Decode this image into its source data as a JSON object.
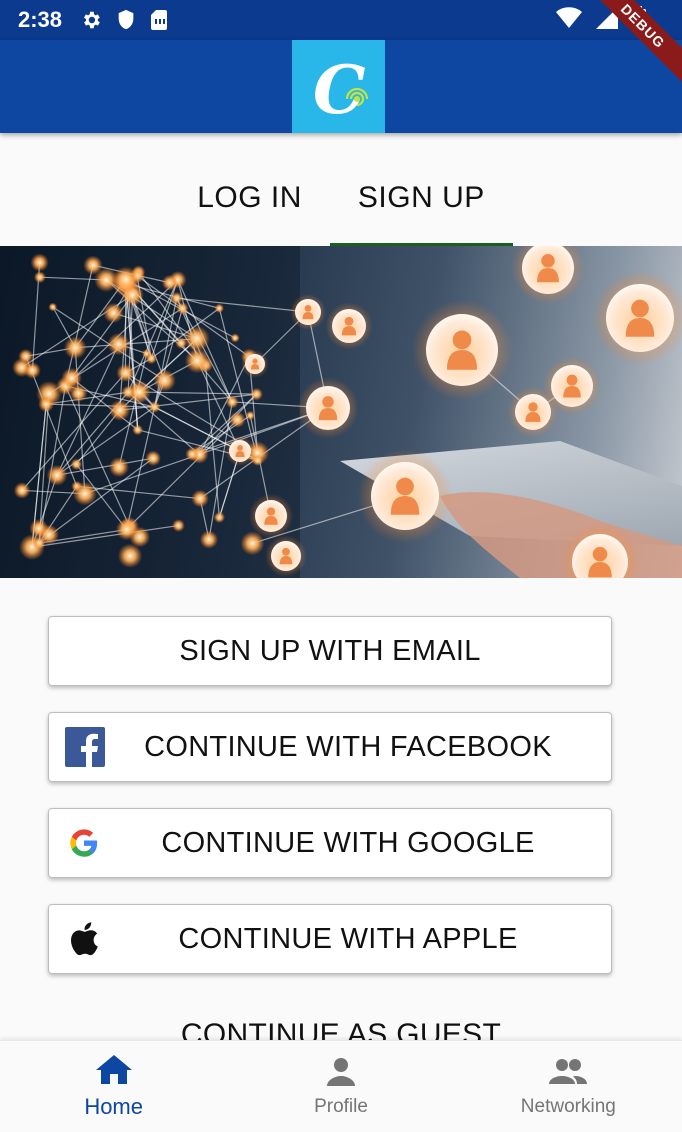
{
  "status_bar": {
    "time": "2:38",
    "icons": [
      "settings-icon",
      "shield-icon",
      "sim-card-icon",
      "wifi-icon",
      "signal-icon",
      "battery-icon"
    ]
  },
  "app_bar": {
    "logo_letter": "C",
    "debug_banner": "DEBUG",
    "color": "#0d47a1",
    "logo_bg": "#29b6e8"
  },
  "tabs": [
    {
      "label": "LOG IN",
      "active": false
    },
    {
      "label": "SIGN UP",
      "active": true
    }
  ],
  "hero": {
    "icon": "network-people-image"
  },
  "buttons": {
    "email": {
      "label": "SIGN UP WITH EMAIL"
    },
    "facebook": {
      "label": "CONTINUE WITH FACEBOOK",
      "icon": "facebook-icon"
    },
    "google": {
      "label": "CONTINUE WITH GOOGLE",
      "icon": "google-icon"
    },
    "apple": {
      "label": "CONTINUE WITH APPLE",
      "icon": "apple-icon"
    }
  },
  "guest_label": "CONTINUE AS GUEST",
  "bottom_nav": [
    {
      "label": "Home",
      "icon": "home-icon",
      "active": true
    },
    {
      "label": "Profile",
      "icon": "person-icon",
      "active": false
    },
    {
      "label": "Networking",
      "icon": "people-icon",
      "active": false
    }
  ],
  "colors": {
    "primary": "#0d47a1",
    "tab_indicator": "#1b5e20",
    "facebook": "#3b5998"
  }
}
